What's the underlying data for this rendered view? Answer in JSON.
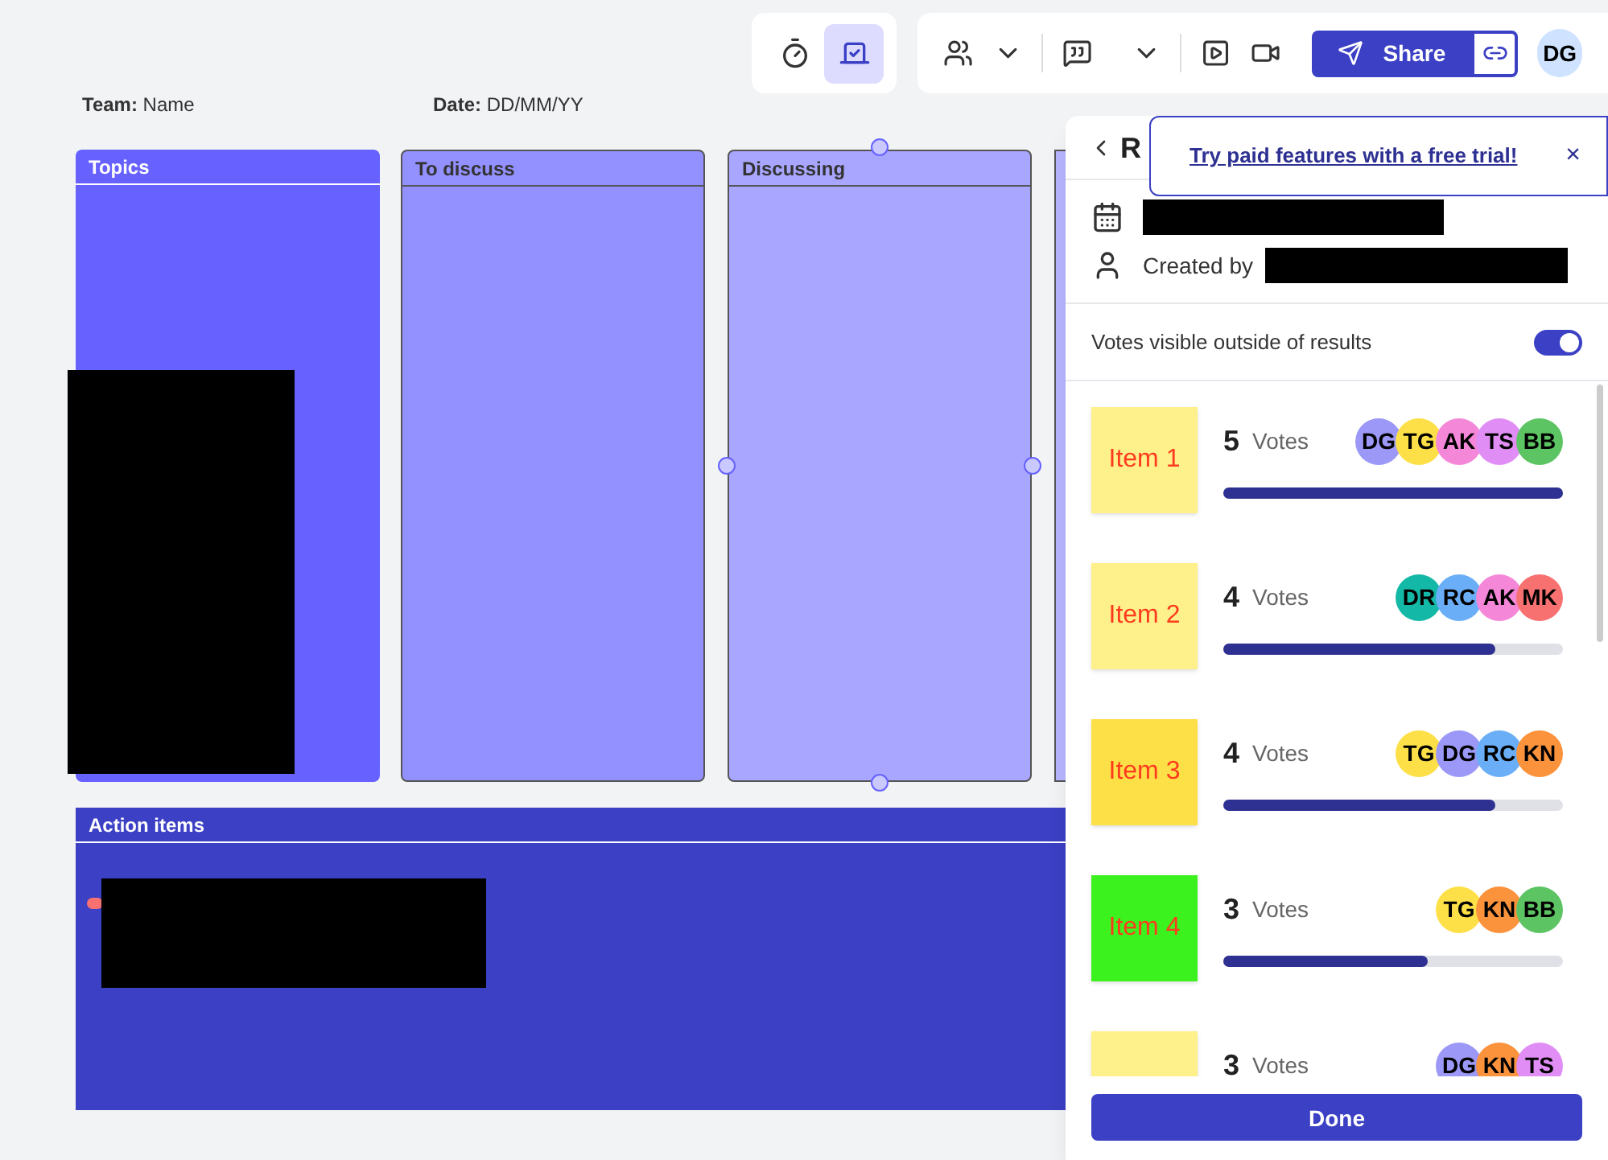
{
  "board": {
    "team_label": "Team:",
    "team_value": "Name",
    "date_label": "Date:",
    "date_value": "DD/MM/YY",
    "frames": [
      {
        "title": "Topics",
        "color": "#6661ff"
      },
      {
        "title": "To discuss",
        "color": "#9391ff"
      },
      {
        "title": "Discussing",
        "color": "#a8a6ff"
      }
    ],
    "action_frame": {
      "title": "Action items",
      "color": "#3b40c4"
    }
  },
  "toolbar": {
    "share": "Share",
    "avatar": "DG"
  },
  "panel": {
    "header": "R",
    "created_by": "Created by",
    "toggle_label": "Votes visible outside of results",
    "toggle_on": true,
    "items": [
      {
        "label": "Item 1",
        "color": "#fef08a",
        "count": "5",
        "unit": "Votes",
        "level": 1.0,
        "voters": [
          {
            "initials": "DG",
            "color": "#9b98f7"
          },
          {
            "initials": "TG",
            "color": "#fde047"
          },
          {
            "initials": "AK",
            "color": "#f587d8"
          },
          {
            "initials": "TS",
            "color": "#e08ef5"
          },
          {
            "initials": "BB",
            "color": "#5cc462"
          }
        ]
      },
      {
        "label": "Item 2",
        "color": "#fef08a",
        "count": "4",
        "unit": "Votes",
        "level": 0.8,
        "voters": [
          {
            "initials": "DR",
            "color": "#14b8a6"
          },
          {
            "initials": "RC",
            "color": "#6aaef7"
          },
          {
            "initials": "AK",
            "color": "#f587d8"
          },
          {
            "initials": "MK",
            "color": "#f87171"
          }
        ]
      },
      {
        "label": "Item 3",
        "color": "#fde047",
        "count": "4",
        "unit": "Votes",
        "level": 0.8,
        "voters": [
          {
            "initials": "TG",
            "color": "#fde047"
          },
          {
            "initials": "DG",
            "color": "#9b98f7"
          },
          {
            "initials": "RC",
            "color": "#6aaef7"
          },
          {
            "initials": "KN",
            "color": "#fb923c"
          }
        ]
      },
      {
        "label": "Item 4",
        "color": "#3cf21e",
        "count": "3",
        "unit": "Votes",
        "level": 0.6,
        "voters": [
          {
            "initials": "TG",
            "color": "#fde047"
          },
          {
            "initials": "KN",
            "color": "#fb923c"
          },
          {
            "initials": "BB",
            "color": "#5cc462"
          }
        ]
      },
      {
        "color": "#fef08a",
        "count": "3",
        "unit": "Votes",
        "voters": [
          {
            "initials": "DG",
            "color": "#9b98f7"
          },
          {
            "initials": "KN",
            "color": "#fb923c"
          },
          {
            "initials": "TS",
            "color": "#e08ef5"
          }
        ]
      }
    ],
    "done": "Done"
  },
  "toast": {
    "link": "Try paid features with a free trial!",
    "close": "×"
  }
}
